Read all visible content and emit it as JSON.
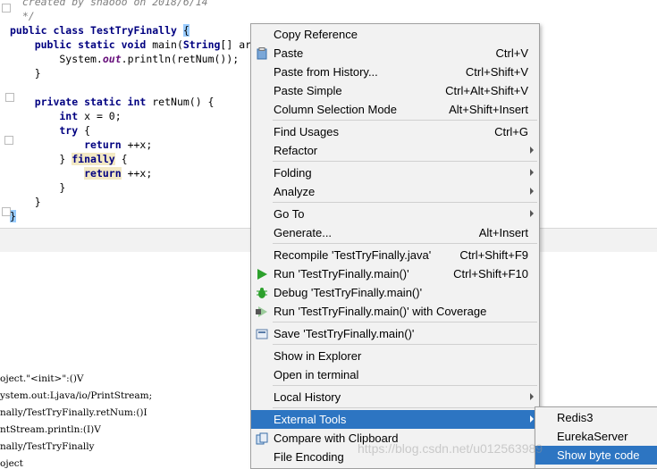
{
  "editor": {
    "lines": [
      [
        {
          "t": "  created by shaooo on 2018/6/14",
          "c": "cm"
        }
      ],
      [
        {
          "t": "  */",
          "c": "cm"
        }
      ],
      [
        {
          "t": "public class ",
          "c": "kw"
        },
        {
          "t": "TestTryFinally ",
          "c": "kw"
        },
        {
          "t": "{",
          "c": "brace-hl"
        }
      ],
      [
        {
          "t": "    public static void ",
          "c": "kw"
        },
        {
          "t": "main(",
          "c": ""
        },
        {
          "t": "String",
          "c": "kw"
        },
        {
          "t": "[] ar",
          "c": ""
        }
      ],
      [
        {
          "t": "        System.",
          "c": ""
        },
        {
          "t": "out",
          "c": "fd"
        },
        {
          "t": ".println(retNum());",
          "c": ""
        }
      ],
      [
        {
          "t": "    }",
          "c": ""
        }
      ],
      [
        {
          "t": "",
          "c": ""
        }
      ],
      [
        {
          "t": "    private static int ",
          "c": "kw"
        },
        {
          "t": "retNum() {",
          "c": ""
        }
      ],
      [
        {
          "t": "        int ",
          "c": "kw"
        },
        {
          "t": "x = 0;",
          "c": ""
        }
      ],
      [
        {
          "t": "        try ",
          "c": "kw"
        },
        {
          "t": "{",
          "c": ""
        }
      ],
      [
        {
          "t": "            return ",
          "c": "kw"
        },
        {
          "t": "++x;",
          "c": ""
        }
      ],
      [
        {
          "t": "        } ",
          "c": ""
        },
        {
          "t": "finally",
          "c": "kw kw-hl"
        },
        {
          "t": " {",
          "c": ""
        }
      ],
      [
        {
          "t": "            ",
          "c": ""
        },
        {
          "t": "return",
          "c": "kw kw-hl"
        },
        {
          "t": " ++x;",
          "c": ""
        }
      ],
      [
        {
          "t": "        }",
          "c": ""
        }
      ],
      [
        {
          "t": "    }",
          "c": ""
        }
      ],
      [
        {
          "t": "}",
          "c": "brace-hl"
        }
      ]
    ]
  },
  "console": {
    "lines": [
      "oject.\"<init>\":()V",
      "ystem.out:Ljava/io/PrintStream;",
      "nally/TestTryFinally.retNum:()I",
      "ntStream.println:(I)V",
      "nally/TestTryFinally",
      "oject"
    ]
  },
  "menu": {
    "items": [
      {
        "id": "copy-reference",
        "label": "Copy Reference",
        "shortcut": "",
        "submenu": false,
        "icon": ""
      },
      {
        "id": "paste",
        "label": "Paste",
        "shortcut": "Ctrl+V",
        "submenu": false,
        "icon": "clipboard-icon"
      },
      {
        "id": "paste-from-history",
        "label": "Paste from History...",
        "shortcut": "Ctrl+Shift+V",
        "submenu": false,
        "icon": ""
      },
      {
        "id": "paste-simple",
        "label": "Paste Simple",
        "shortcut": "Ctrl+Alt+Shift+V",
        "submenu": false,
        "icon": ""
      },
      {
        "id": "column-selection-mode",
        "label": "Column Selection Mode",
        "shortcut": "Alt+Shift+Insert",
        "submenu": false,
        "icon": ""
      },
      {
        "sep": true
      },
      {
        "id": "find-usages",
        "label": "Find Usages",
        "shortcut": "Ctrl+G",
        "submenu": false,
        "icon": ""
      },
      {
        "id": "refactor",
        "label": "Refactor",
        "shortcut": "",
        "submenu": true,
        "icon": ""
      },
      {
        "sep": true
      },
      {
        "id": "folding",
        "label": "Folding",
        "shortcut": "",
        "submenu": true,
        "icon": ""
      },
      {
        "id": "analyze",
        "label": "Analyze",
        "shortcut": "",
        "submenu": true,
        "icon": ""
      },
      {
        "sep": true
      },
      {
        "id": "go-to",
        "label": "Go To",
        "shortcut": "",
        "submenu": true,
        "icon": ""
      },
      {
        "id": "generate",
        "label": "Generate...",
        "shortcut": "Alt+Insert",
        "submenu": false,
        "icon": ""
      },
      {
        "sep": true
      },
      {
        "id": "recompile",
        "label": "Recompile 'TestTryFinally.java'",
        "shortcut": "Ctrl+Shift+F9",
        "submenu": false,
        "icon": ""
      },
      {
        "id": "run",
        "label": "Run 'TestTryFinally.main()'",
        "shortcut": "Ctrl+Shift+F10",
        "submenu": false,
        "icon": "run-icon"
      },
      {
        "id": "debug",
        "label": "Debug 'TestTryFinally.main()'",
        "shortcut": "",
        "submenu": false,
        "icon": "debug-icon"
      },
      {
        "id": "run-with-coverage",
        "label": "Run 'TestTryFinally.main()' with Coverage",
        "shortcut": "",
        "submenu": false,
        "icon": "coverage-icon"
      },
      {
        "sep": true
      },
      {
        "id": "save",
        "label": "Save 'TestTryFinally.main()'",
        "shortcut": "",
        "submenu": false,
        "icon": "save-config-icon"
      },
      {
        "sep": true
      },
      {
        "id": "show-in-explorer",
        "label": "Show in Explorer",
        "shortcut": "",
        "submenu": false,
        "icon": ""
      },
      {
        "id": "open-in-terminal",
        "label": "Open in terminal",
        "shortcut": "",
        "submenu": false,
        "icon": ""
      },
      {
        "sep": true
      },
      {
        "id": "local-history",
        "label": "Local History",
        "shortcut": "",
        "submenu": true,
        "icon": ""
      },
      {
        "sep": true
      },
      {
        "id": "external-tools",
        "label": "External Tools",
        "shortcut": "",
        "submenu": true,
        "icon": "",
        "selected": true
      },
      {
        "id": "compare-with-clipboard",
        "label": "Compare with Clipboard",
        "shortcut": "",
        "submenu": false,
        "icon": "compare-icon"
      },
      {
        "id": "file-encoding",
        "label": "File Encoding",
        "shortcut": "",
        "submenu": false,
        "icon": ""
      }
    ]
  },
  "submenu": {
    "items": [
      {
        "id": "redis3",
        "label": "Redis3",
        "selected": false
      },
      {
        "id": "eurekaserver",
        "label": "EurekaServer",
        "selected": false
      },
      {
        "id": "show-byte-code",
        "label": "Show byte code",
        "selected": true
      }
    ]
  },
  "watermark": "https://blog.csdn.net/u012563989",
  "colors": {
    "selection": "#2d75c2",
    "menu_bg": "#f2f2f2",
    "keyword": "#000080",
    "run_green": "#2ca02c"
  }
}
